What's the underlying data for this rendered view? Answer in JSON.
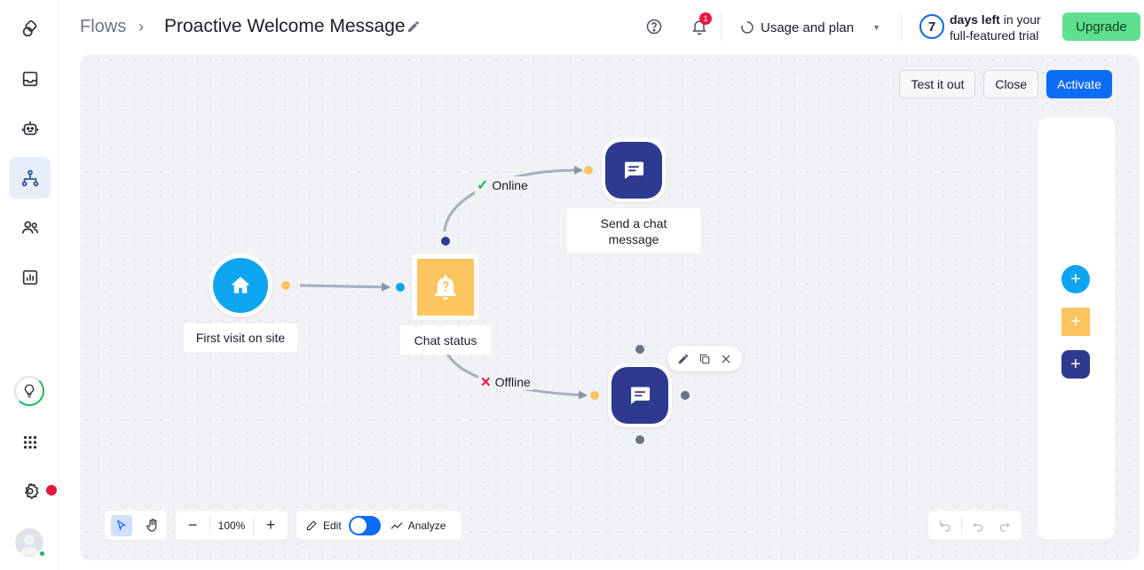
{
  "breadcrumb": {
    "root": "Flows",
    "separator": "›",
    "title": "Proactive Welcome Message"
  },
  "header": {
    "notification_count": "1",
    "usage_label": "Usage and plan",
    "trial_days": "7",
    "trial_bold": "days left",
    "trial_rest_1": " in your",
    "trial_line_2": "full-featured trial",
    "upgrade_label": "Upgrade"
  },
  "canvas_actions": {
    "test_label": "Test it out",
    "close_label": "Close",
    "activate_label": "Activate"
  },
  "nodes": {
    "first_visit": "First visit on site",
    "chat_status": "Chat status",
    "send_message": "Send a chat message"
  },
  "edges": {
    "online": "Online",
    "offline": "Offline"
  },
  "bottom_toolbar": {
    "zoom": "100%",
    "edit_label": "Edit",
    "analyze_label": "Analyze",
    "mode_edit_on": true
  },
  "sidebar": {
    "items": [
      {
        "icon": "logo-icon"
      },
      {
        "icon": "inbox-icon"
      },
      {
        "icon": "bot-icon"
      },
      {
        "icon": "flows-icon",
        "active": true
      },
      {
        "icon": "contacts-icon"
      },
      {
        "icon": "analytics-icon"
      }
    ]
  },
  "colors": {
    "accent": "#0b6cf5",
    "upgrade": "#5fe08f",
    "trigger": "#0ea5f0",
    "condition": "#fcc45f",
    "action": "#2e3a8f",
    "badge": "#e5173f"
  }
}
